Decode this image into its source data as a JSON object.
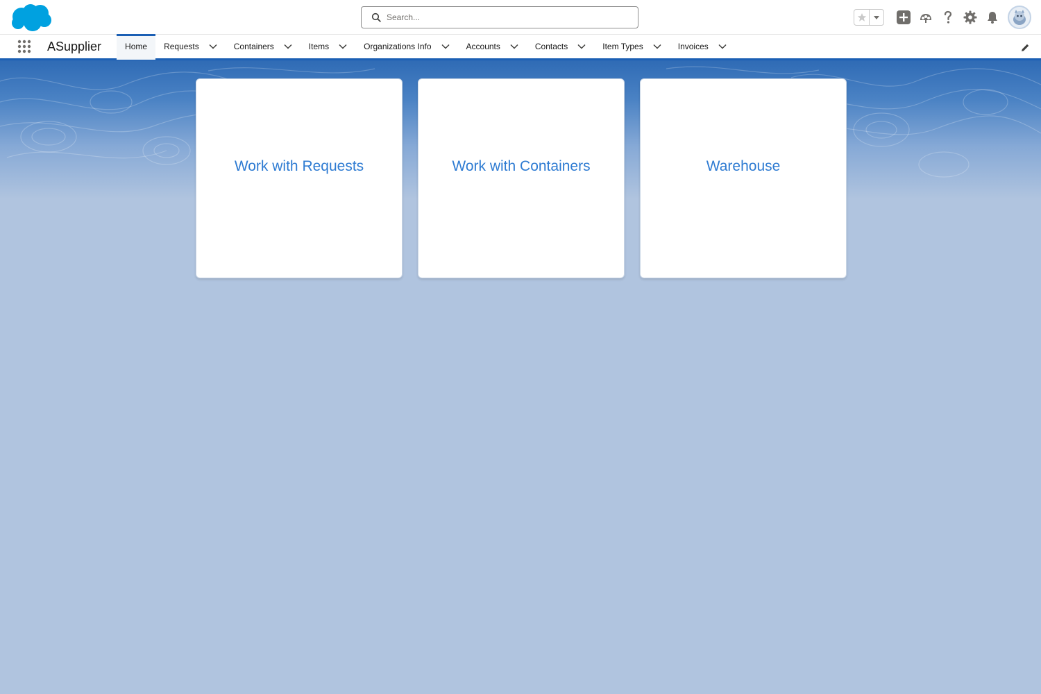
{
  "header": {
    "search": {
      "placeholder": "Search..."
    },
    "icons": [
      "favorites-star-icon",
      "favorites-menu-icon",
      "global-actions-icon",
      "trailhead-icon",
      "help-icon",
      "setup-gear-icon",
      "notifications-bell-icon",
      "user-avatar"
    ]
  },
  "nav": {
    "app_name": "ASupplier",
    "items": [
      {
        "label": "Home",
        "active": true,
        "has_menu": false
      },
      {
        "label": "Requests",
        "has_menu": true
      },
      {
        "label": "Containers",
        "has_menu": true
      },
      {
        "label": "Items",
        "has_menu": true
      },
      {
        "label": "Organizations Info",
        "has_menu": true
      },
      {
        "label": "Accounts",
        "has_menu": true
      },
      {
        "label": "Contacts",
        "has_menu": true
      },
      {
        "label": "Item Types",
        "has_menu": true
      },
      {
        "label": "Invoices",
        "has_menu": true
      }
    ]
  },
  "tiles": [
    {
      "label": "Work with Requests"
    },
    {
      "label": "Work with Containers"
    },
    {
      "label": "Warehouse"
    }
  ],
  "colors": {
    "brand": "#00a1e0",
    "accent": "#1b5fb4",
    "link": "#2e7bd2",
    "page_bg": "#b0c4df"
  }
}
